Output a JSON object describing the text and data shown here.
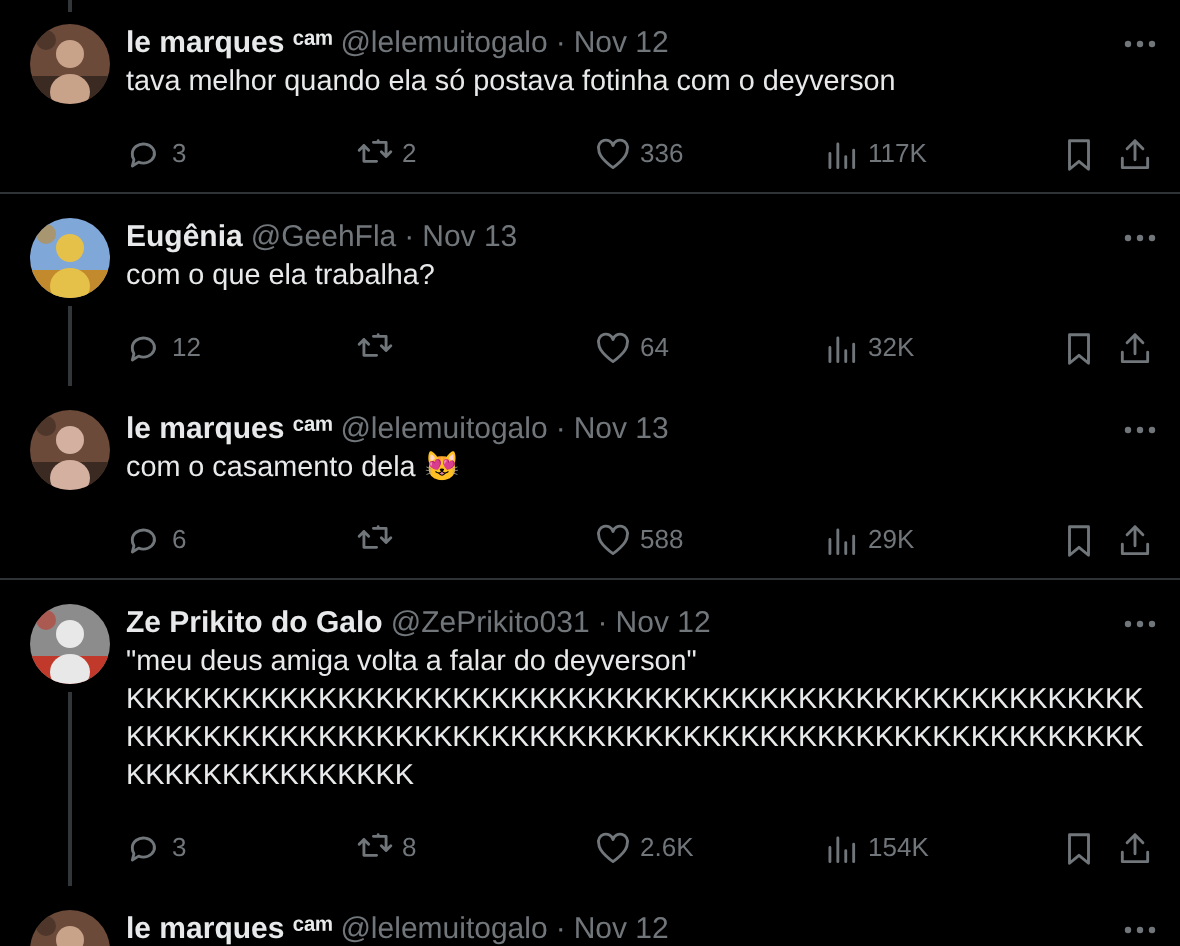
{
  "tweets": [
    {
      "name": "le marques ᶜᵃᵐ",
      "handle": "@lelemuitogalo",
      "separator": "·",
      "date": "Nov 12",
      "text": [
        "tava melhor quando ela só postava fotinha com o deyverson"
      ],
      "replies": "3",
      "reposts": "2",
      "likes": "336",
      "views": "117K",
      "thread_above": true,
      "thread_below": false,
      "divider_below": true,
      "avatar": {
        "kind": "picture"
      }
    },
    {
      "name": "Eugênia",
      "handle": "@GeehFla",
      "separator": "·",
      "date": "Nov 13",
      "text": [
        "com o que ela trabalha?"
      ],
      "replies": "12",
      "likes": "64",
      "views": "32K",
      "thread_above": false,
      "thread_below": true,
      "divider_below": false,
      "avatar": {
        "kind": "picture"
      }
    },
    {
      "name": "le marques ᶜᵃᵐ",
      "handle": "@lelemuitogalo",
      "separator": "·",
      "date": "Nov 13",
      "text": [
        "com o casamento dela 😻"
      ],
      "replies": "6",
      "likes": "588",
      "views": "29K",
      "thread_above": false,
      "thread_below": false,
      "divider_below": true,
      "avatar": {
        "kind": "picture"
      }
    },
    {
      "name": "Ze Prikito do Galo",
      "handle": "@ZePrikito031",
      "separator": "·",
      "date": "Nov 12",
      "text": [
        "\"meu deus amiga volta a falar do deyverson\"",
        "KKKKKKKKKKKKKKKKKKKKKKKKKKKKKKKKKKKKKKKKKKKKKKKKKKKKKKKKKKKKKKKKKKKKKKKKKKKKKKKKKKKKKKKKKKKKKKKKKKKKKKKKKKKKKKKKKKKKKKKKK"
      ],
      "replies": "3",
      "reposts": "8",
      "likes": "2.6K",
      "views": "154K",
      "thread_above": false,
      "thread_below": true,
      "divider_below": false,
      "avatar": {
        "kind": "picture"
      }
    },
    {
      "name": "le marques ᶜᵃᵐ",
      "handle": "@lelemuitogalo",
      "separator": "·",
      "date": "Nov 12",
      "thread_above": false,
      "avatar": {
        "kind": "picture"
      }
    }
  ]
}
